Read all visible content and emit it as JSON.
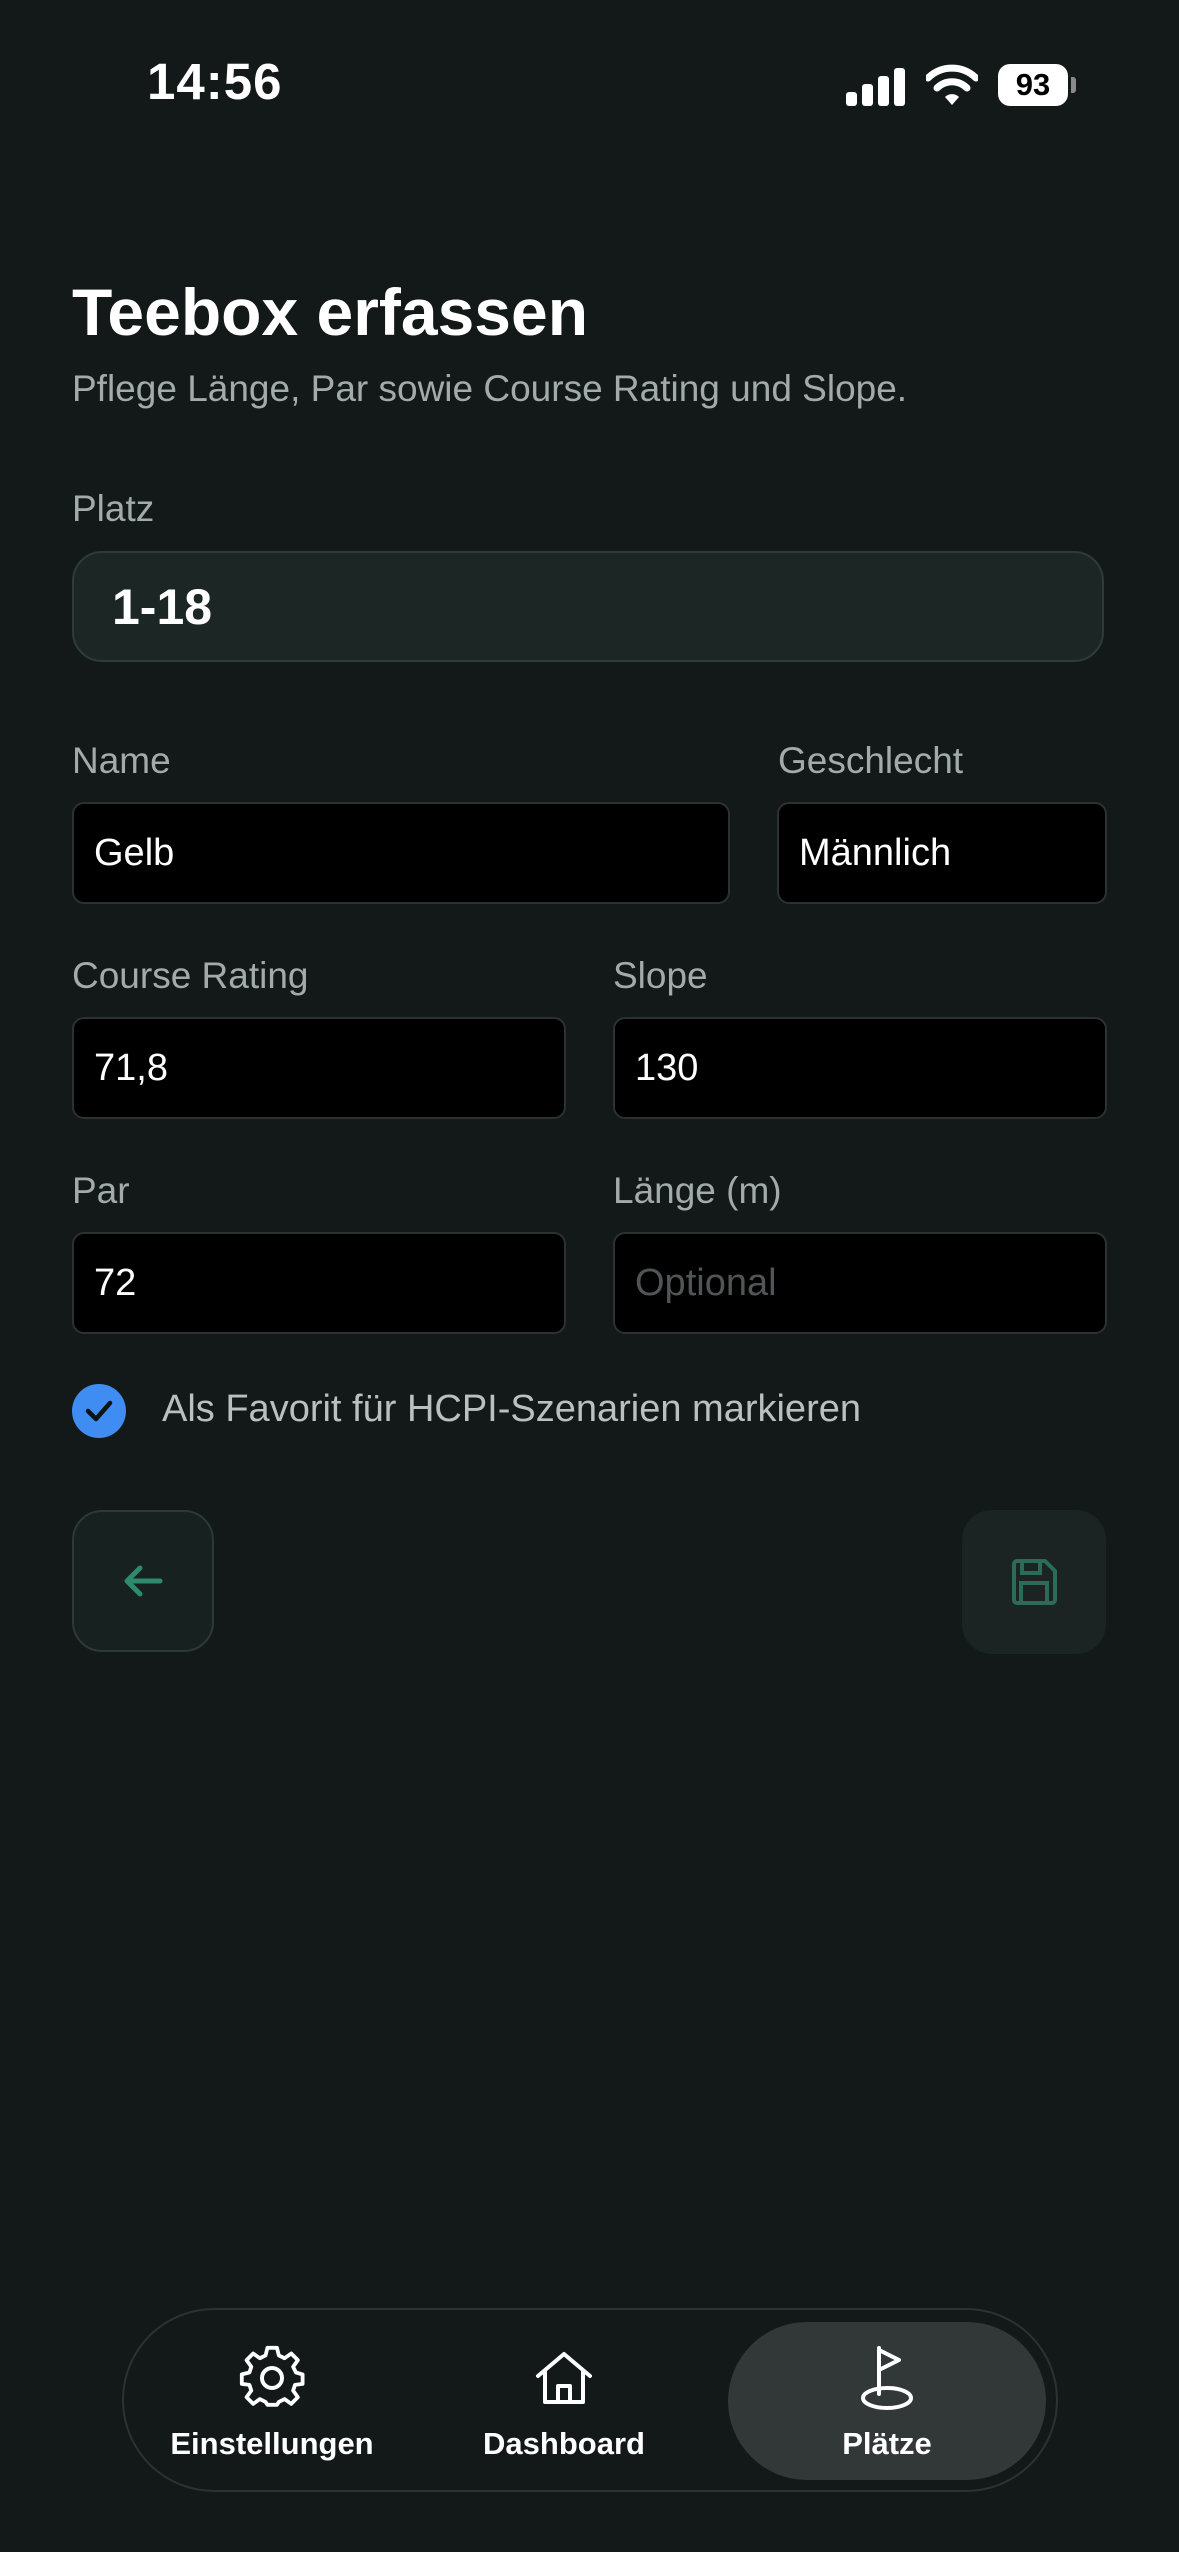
{
  "status_bar": {
    "time": "14:56",
    "battery": "93"
  },
  "header": {
    "title": "Teebox erfassen",
    "subtitle": "Pflege Länge, Par sowie Course Rating und Slope."
  },
  "form": {
    "platz": {
      "label": "Platz",
      "value": "1-18"
    },
    "name": {
      "label": "Name",
      "value": "Gelb"
    },
    "geschlecht": {
      "label": "Geschlecht",
      "value": "Männlich"
    },
    "course_rating": {
      "label": "Course Rating",
      "value": "71,8"
    },
    "slope": {
      "label": "Slope",
      "value": "130"
    },
    "par": {
      "label": "Par",
      "value": "72"
    },
    "laenge": {
      "label": "Länge (m)",
      "value": "",
      "placeholder": "Optional"
    },
    "favorite": {
      "label": "Als Favorit für HCPI-Szenarien markieren",
      "checked": true
    }
  },
  "colors": {
    "background": "#131918",
    "accent_green": "#2f8a6c",
    "checkbox_blue": "#3f8cf2"
  },
  "tabbar": {
    "items": [
      {
        "label": "Einstellungen",
        "icon": "gear-icon",
        "active": false
      },
      {
        "label": "Dashboard",
        "icon": "home-icon",
        "active": false
      },
      {
        "label": "Plätze",
        "icon": "golf-flag-icon",
        "active": true
      }
    ]
  }
}
